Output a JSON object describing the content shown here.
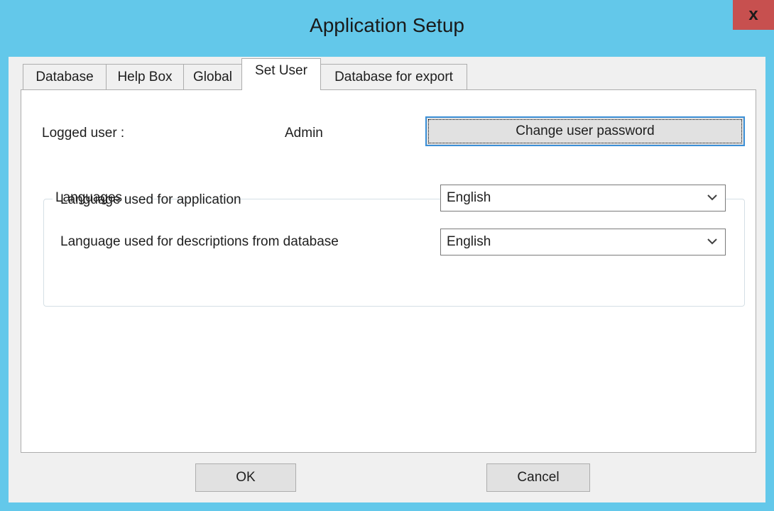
{
  "window": {
    "title": "Application Setup",
    "close_glyph": "x",
    "close_icon": "close-icon"
  },
  "tabs": [
    {
      "label": "Database"
    },
    {
      "label": "Help Box"
    },
    {
      "label": "Global"
    },
    {
      "label": "Set User",
      "active": true
    },
    {
      "label": "Database for export"
    }
  ],
  "set_user": {
    "logged_user_label": "Logged user :",
    "logged_user_value": "Admin",
    "change_password_label": "Change user password"
  },
  "languages": {
    "group_label": "Languages",
    "application": {
      "label": "Language used for application",
      "value": "English"
    },
    "descriptions": {
      "label": "Language used for descriptions from database",
      "value": "English"
    }
  },
  "footer": {
    "ok_label": "OK",
    "cancel_label": "Cancel"
  },
  "colors": {
    "titlebar": "#63c8ea",
    "close_button": "#c7504f",
    "dialog_background": "#f0f0f0",
    "focus_border": "#3b8fd6"
  }
}
